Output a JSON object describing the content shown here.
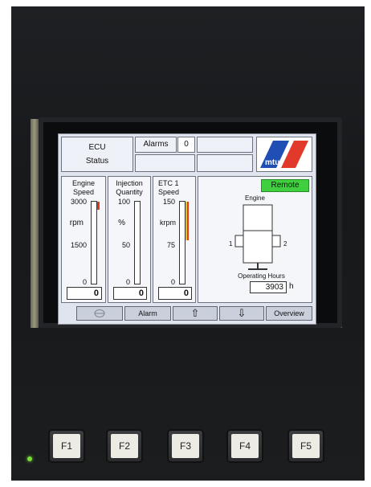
{
  "header": {
    "ecu_status_line1": "ECU",
    "ecu_status_line2": "Status",
    "alarms_label": "Alarms",
    "alarms_count": "0",
    "logo_text": "mtu"
  },
  "gauges": [
    {
      "title1": "Engine",
      "title2": "Speed",
      "scale_top": "3000",
      "unit": "rpm",
      "scale_mid": "1500",
      "scale_bottom": "0",
      "value": "0"
    },
    {
      "title1": "Injection",
      "title2": "Quantity",
      "scale_top": "100",
      "unit": "%",
      "scale_mid": "50",
      "scale_bottom": "0",
      "value": "0"
    },
    {
      "title1": "ETC 1",
      "title2": "Speed",
      "scale_top": "150",
      "unit": "krpm",
      "scale_mid": "75",
      "scale_bottom": "0",
      "value": "0"
    }
  ],
  "engine_panel": {
    "remote_label": "Remote",
    "engine_label": "Engine",
    "bank_left": "1",
    "bank_right": "2",
    "operating_hours_label": "Operating Hours",
    "operating_hours_value": "3903",
    "operating_hours_unit": "h"
  },
  "softkeys": {
    "alarm": "Alarm",
    "up": "⇧",
    "down": "⇩",
    "overview": "Overview"
  },
  "function_keys": [
    "F1",
    "F2",
    "F3",
    "F4",
    "F5"
  ],
  "colors": {
    "remote_active": "#3fcf3f",
    "gauge_warning": "#e8c21a",
    "gauge_alarm": "#e03a1e",
    "mtu_blue": "#1f4fb5",
    "mtu_red": "#e23a2a"
  }
}
